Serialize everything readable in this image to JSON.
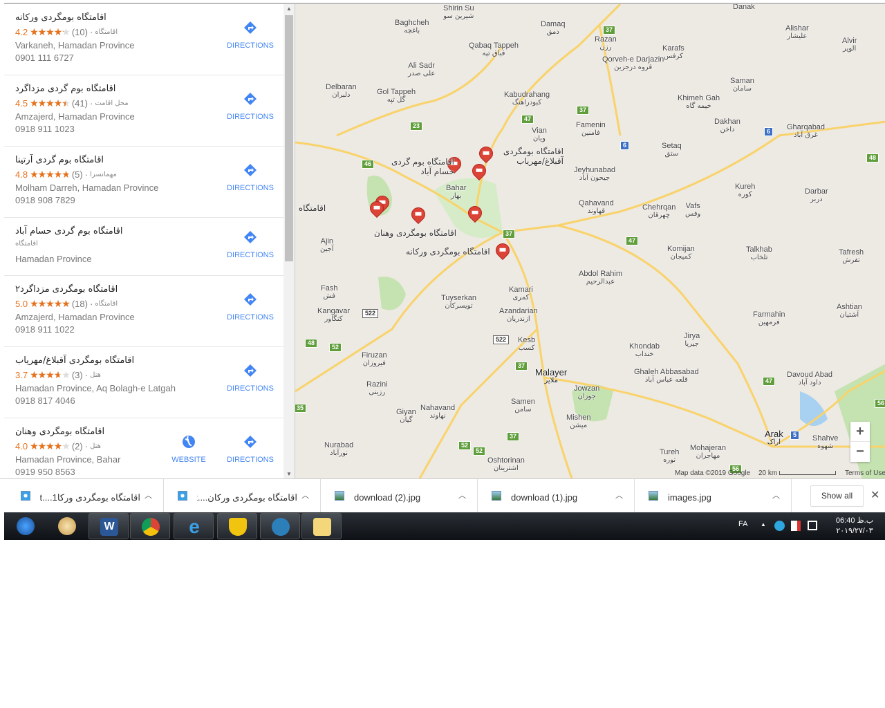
{
  "results": [
    {
      "name": "اقامتگاه بومگردی ورکانه",
      "rating": "4.2",
      "rating_value": 4.2,
      "reviews": "(10)",
      "category": "اقامتگاه",
      "address": "Varkaneh, Hamadan Province",
      "phone": "0901 111 6727",
      "directions": "DIRECTIONS"
    },
    {
      "name": "اقامتگاه بوم گردی مزداگرد",
      "rating": "4.5",
      "rating_value": 4.5,
      "reviews": "(41)",
      "category": "محل اقامت",
      "address": "Amzajerd, Hamadan Province",
      "phone": "0918 911 1023",
      "directions": "DIRECTIONS"
    },
    {
      "name": "اقامتگاه بوم گردی آرتینا",
      "rating": "4.8",
      "rating_value": 4.8,
      "reviews": "(5)",
      "category": "مهمانسرا",
      "address": "Molham Darreh, Hamadan Province",
      "phone": "0918 908 7829",
      "directions": "DIRECTIONS"
    },
    {
      "name": "اقامتگاه بوم گردی حسام آباد",
      "category": "اقامتگاه",
      "address": "Hamadan Province",
      "directions": "DIRECTIONS"
    },
    {
      "name": "اقامتگاه بومگردی مزداگرد۲",
      "rating": "5.0",
      "rating_value": 5.0,
      "reviews": "(18)",
      "category": "اقامتگاه",
      "address": "Amzajerd, Hamadan Province",
      "phone": "0918 911 1022",
      "directions": "DIRECTIONS"
    },
    {
      "name": "اقامتگاه بومگردی آقبلاغ/مهریاب",
      "rating": "3.7",
      "rating_value": 3.7,
      "reviews": "(3)",
      "category": "هتل",
      "address": "Hamadan Province, Aq Bolagh-e Latgah",
      "phone": "0918 817 4046",
      "directions": "DIRECTIONS"
    },
    {
      "name": "اقامتگاه بومگردی وهنان",
      "rating": "4.0",
      "rating_value": 4.0,
      "reviews": "(2)",
      "category": "هتل",
      "address": "Hamadan Province, Bahar",
      "phone": "0919 950 8563",
      "website": "WEBSITE",
      "directions": "DIRECTIONS"
    }
  ],
  "map": {
    "places": [
      {
        "en": "Shirin Su",
        "fa": "شیرین سو"
      },
      {
        "en": "Baghcheh",
        "fa": "باغچه"
      },
      {
        "en": "Damaq",
        "fa": "دمق"
      },
      {
        "en": "Razan",
        "fa": "رزن"
      },
      {
        "en": "Alishar",
        "fa": "عليشار"
      },
      {
        "en": "Alvir",
        "fa": "الویر"
      },
      {
        "en": "Qabaq Tappeh",
        "fa": "قباق تپه"
      },
      {
        "en": "Qorveh-e Darjazin",
        "fa": "قروه درجزین"
      },
      {
        "en": "Karafs",
        "fa": "کرفس"
      },
      {
        "en": "Ali Sadr",
        "fa": "علی صدر"
      },
      {
        "en": "Delbaran",
        "fa": "دلبران"
      },
      {
        "en": "Gol Tappeh",
        "fa": "گل تپه"
      },
      {
        "en": "Kabudrahang",
        "fa": "کبودراهنگ"
      },
      {
        "en": "Saman",
        "fa": "سامان"
      },
      {
        "en": "Khimeh Gah",
        "fa": "خیمه گاه"
      },
      {
        "en": "Famenin",
        "fa": "فامنین"
      },
      {
        "en": "Dakhan",
        "fa": "داخن"
      },
      {
        "en": "Gharqabad",
        "fa": "غرق آباد"
      },
      {
        "en": "Vian",
        "fa": "ویان"
      },
      {
        "en": "Setaq",
        "fa": "ستق"
      },
      {
        "en": "Jeyhunabad",
        "fa": "جیحون آباد"
      },
      {
        "en": "Bahar",
        "fa": "بهار"
      },
      {
        "en": "Kureh",
        "fa": "کوره"
      },
      {
        "en": "Darbar",
        "fa": "دربر"
      },
      {
        "en": "Qahavand",
        "fa": "قهاوند"
      },
      {
        "en": "Chehrqan",
        "fa": "چهرقان"
      },
      {
        "en": "Vafs",
        "fa": "وفس"
      },
      {
        "en": "Ajin",
        "fa": "آجین"
      },
      {
        "en": "Komijan",
        "fa": "کمیجان"
      },
      {
        "en": "Talkhab",
        "fa": "تلخاب"
      },
      {
        "en": "Tafresh",
        "fa": "تفرش"
      },
      {
        "en": "Abdol Rahim",
        "fa": "عبدالرحیم"
      },
      {
        "en": "Fash",
        "fa": "فش"
      },
      {
        "en": "Kamari",
        "fa": "کمری"
      },
      {
        "en": "Tuyserkan",
        "fa": "تویسرکان"
      },
      {
        "en": "Ashtian",
        "fa": "آشتیان"
      },
      {
        "en": "Kangavar",
        "fa": "کنگاور"
      },
      {
        "en": "Azandarian",
        "fa": "ازندریان"
      },
      {
        "en": "Farmahin",
        "fa": "فرمهین"
      },
      {
        "en": "Jirya",
        "fa": "جیریا"
      },
      {
        "en": "Kesb",
        "fa": "کسب"
      },
      {
        "en": "Khondab",
        "fa": "خنداب"
      },
      {
        "en": "Firuzan",
        "fa": "فیروزان"
      },
      {
        "en": "Ghaleh Abbasabad",
        "fa": "قلعه عباس آباد"
      },
      {
        "en": "Malayer",
        "fa": "ملایر"
      },
      {
        "en": "Davoud Abad",
        "fa": "داود آباد"
      },
      {
        "en": "Razini",
        "fa": "رزینی"
      },
      {
        "en": "Jowzan",
        "fa": "جوزان"
      },
      {
        "en": "Samen",
        "fa": "سامن"
      },
      {
        "en": "Nahavand",
        "fa": "نهاوند"
      },
      {
        "en": "Giyan",
        "fa": "گیان"
      },
      {
        "en": "Mishen",
        "fa": "میشن"
      },
      {
        "en": "Arak",
        "fa": "اراک"
      },
      {
        "en": "Shahve",
        "fa": "شهوه"
      },
      {
        "en": "Nurabad",
        "fa": "نورآباد"
      },
      {
        "en": "Mohajeran",
        "fa": "مهاجران"
      },
      {
        "en": "Tureh",
        "fa": "توره"
      },
      {
        "en": "Oshtorinan",
        "fa": "اشترینان"
      },
      {
        "en": "Danak",
        "fa": ""
      }
    ],
    "pin_labels": [
      "اقامتگاه بومگردی آقبلاغ/مهریاب",
      "اقامتگاه بوم گردی حسام آباد",
      "اقامتگاه بومگردی ترا",
      "اقامتگاه بومگردی وهنان",
      "اقامتگاه بومگردی ورکانه"
    ],
    "shields": [
      "37",
      "37",
      "47",
      "23",
      "46",
      "6",
      "6",
      "48",
      "37",
      "47",
      "522",
      "522",
      "48",
      "52",
      "37",
      "47",
      "56",
      "35",
      "37",
      "52",
      "52",
      "5",
      "56"
    ],
    "zoom_in": "+",
    "zoom_out": "−",
    "attribution": "Map data ©2019 Google",
    "scale": "20 km",
    "terms": "Terms of Use",
    "colors": {
      "road": "#f9d36a",
      "park": "#c4e3b0",
      "water": "#a8d0f0",
      "pin": "#db4437"
    }
  },
  "downloads": {
    "items": [
      {
        "name": "اقامتگاه بومگردی ورکا1....ht...",
        "icon": "ie-html-icon"
      },
      {
        "name": "اقامتگاه بومگردی ورکان....ht...",
        "icon": "ie-html-icon"
      },
      {
        "name": "download (2).jpg",
        "icon": "image-file-icon"
      },
      {
        "name": "download (1).jpg",
        "icon": "image-file-icon"
      },
      {
        "name": "images.jpg",
        "icon": "image-file-icon"
      }
    ],
    "show_all": "Show all",
    "close": "✕"
  },
  "taskbar": {
    "lang": "FA",
    "time": "06:40 ب.ظ",
    "date": "۲۰۱۹/۲۷/۰۳"
  }
}
